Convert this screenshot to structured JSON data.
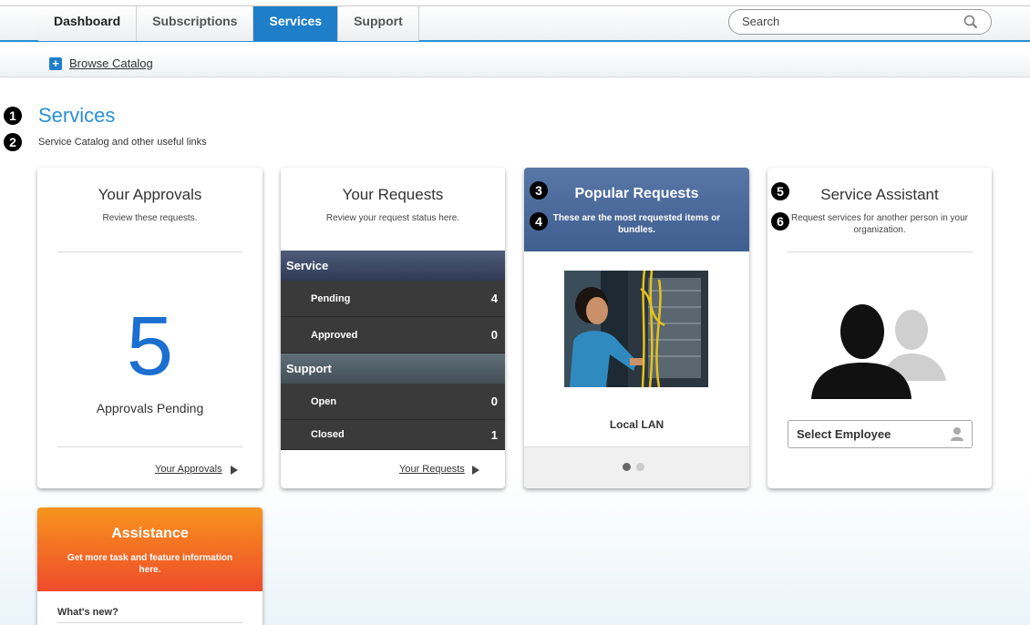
{
  "nav": {
    "tabs": [
      {
        "label": "Dashboard"
      },
      {
        "label": "Subscriptions"
      },
      {
        "label": "Services"
      },
      {
        "label": "Support"
      }
    ],
    "search_placeholder": "Search"
  },
  "subbar": {
    "browse_label": "Browse Catalog"
  },
  "markers": [
    "1",
    "2",
    "3",
    "4",
    "5",
    "6"
  ],
  "page": {
    "title": "Services",
    "subtitle": "Service Catalog and other useful links"
  },
  "approvals": {
    "title": "Your Approvals",
    "desc": "Review these requests.",
    "count": "5",
    "count_label": "Approvals Pending",
    "link": "Your Approvals"
  },
  "requests": {
    "title": "Your Requests",
    "desc": "Review your request status here.",
    "service_header": "Service",
    "service_rows": [
      {
        "label": "Pending",
        "value": "4"
      },
      {
        "label": "Approved",
        "value": "0"
      }
    ],
    "support_header": "Support",
    "support_rows": [
      {
        "label": "Open",
        "value": "0"
      },
      {
        "label": "Closed",
        "value": "1"
      }
    ],
    "link": "Your Requests"
  },
  "popular": {
    "title": "Popular Requests",
    "desc": "These are the most requested items or bundles.",
    "item_label": "Local LAN",
    "dots_total": 2,
    "dots_active": 1
  },
  "assistant": {
    "title": "Service Assistant",
    "desc": "Request services for another person in your organization.",
    "select_label": "Select Employee"
  },
  "assistance": {
    "title": "Assistance",
    "desc": "Get more task and feature information here.",
    "first_item": "What's new?"
  },
  "colors": {
    "accent": "#1e7fc8",
    "popular_header": "#4a6a9a",
    "service_header": "#3c4a66",
    "support_header": "#4e5e66",
    "assistance_top": "#f7941d",
    "assistance_bottom": "#ee4b2b"
  }
}
